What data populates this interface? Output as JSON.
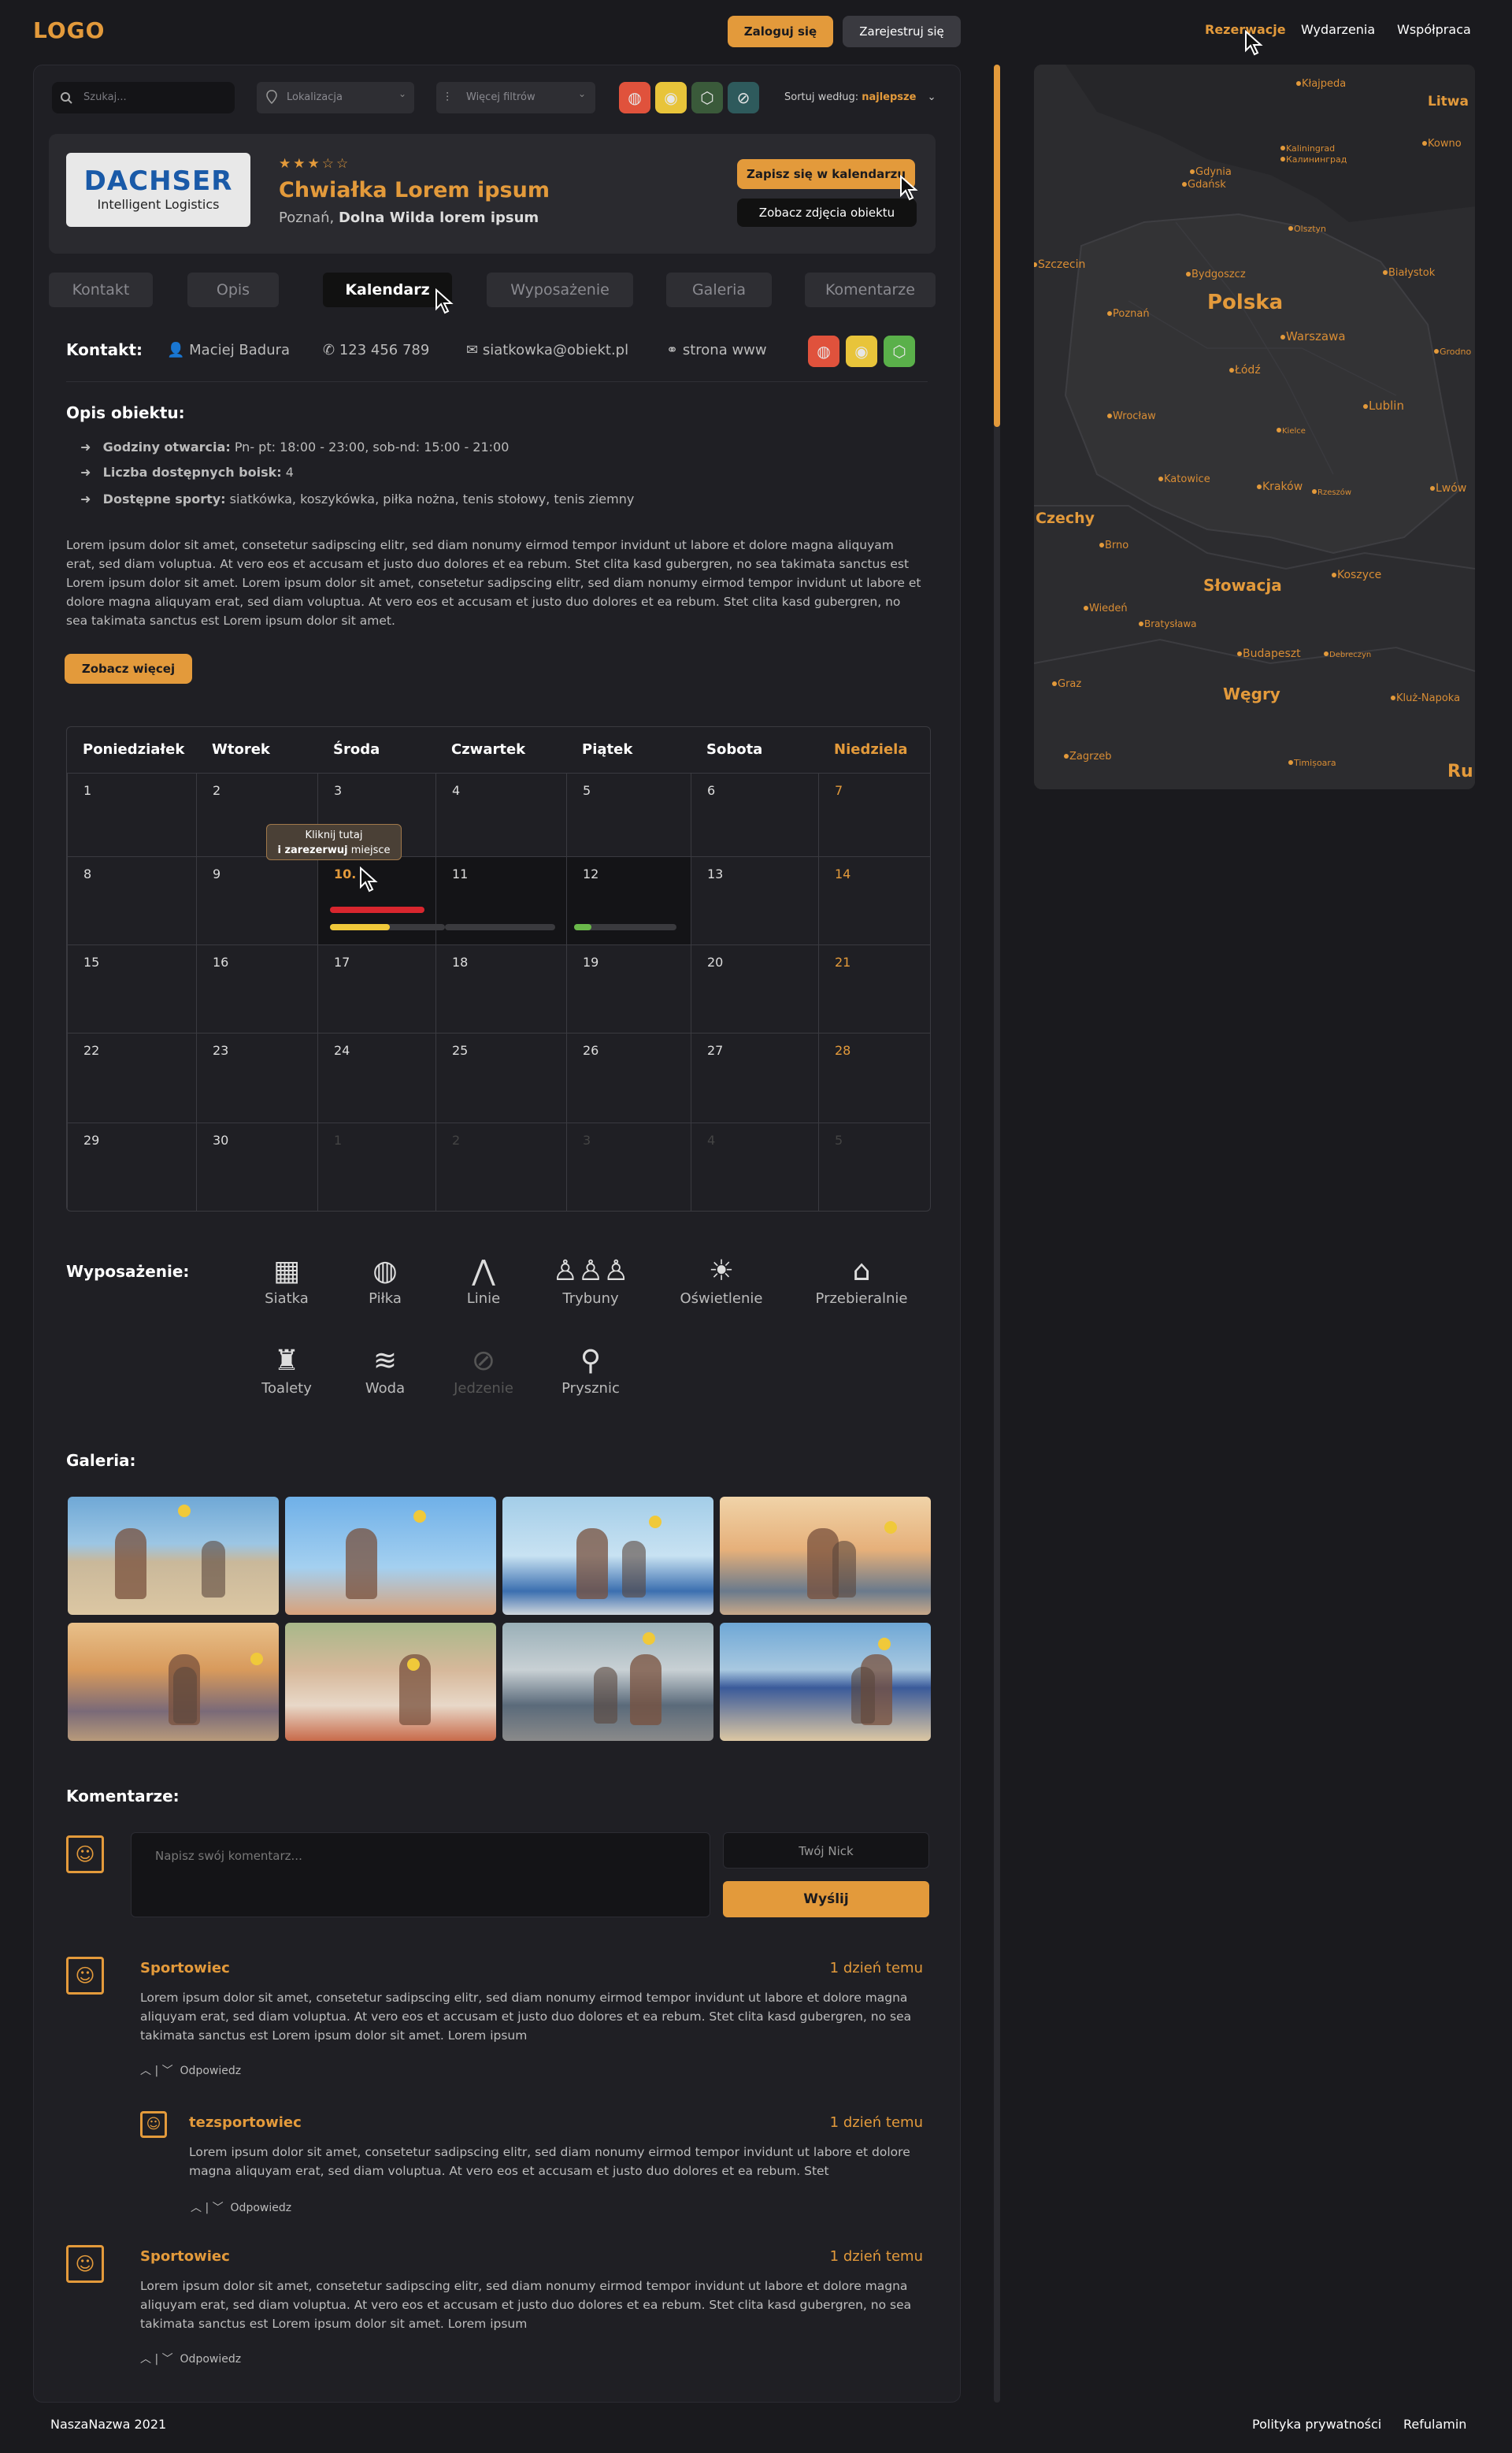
{
  "header": {
    "logo": "LOGO",
    "login": "Zaloguj się",
    "register": "Zarejestruj się",
    "nav": [
      "Rezerwacje",
      "Wydarzenia",
      "Współpraca"
    ]
  },
  "filters": {
    "search_placeholder": "Szukaj...",
    "location": "Lokalizacja",
    "more": "Więcej filtrów",
    "sort_label": "Sortuj według:",
    "sort_value": "najlepsze"
  },
  "facility": {
    "logo_line1": "DACHSER",
    "logo_line2": "Intelligent Logistics",
    "rating": 3.5,
    "stars": "★★★☆☆",
    "name": "Chwiałka Lorem ipsum",
    "city": "Poznań,",
    "street": "Dolna Wilda lorem ipsum",
    "btn_calendar": "Zapisz się w kalendarzu",
    "btn_photos": "Zobacz zdjęcia obiektu"
  },
  "tabs": [
    "Kontakt",
    "Opis",
    "Kalendarz",
    "Wyposażenie",
    "Galeria",
    "Komentarze"
  ],
  "contact": {
    "label": "Kontakt:",
    "person": "Maciej Badura",
    "phone": "123 456 789",
    "email": "siatkowka@obiekt.pl",
    "www": "strona www"
  },
  "description": {
    "heading": "Opis obiektu:",
    "hours_label": "Godziny otwarcia:",
    "hours": "Pn- pt: 18:00 - 23:00,  sob-nd: 15:00 - 21:00",
    "courts_label": "Liczba dostępnych boisk:",
    "courts": "4",
    "sports_label": "Dostępne sporty:",
    "sports": "siatkówka, koszykówka, piłka nożna, tenis stołowy, tenis ziemny",
    "text": "Lorem ipsum dolor sit amet, consetetur sadipscing elitr, sed diam nonumy eirmod tempor invidunt ut labore et dolore magna aliquyam erat, sed diam voluptua. At vero eos et accusam et justo duo dolores et ea rebum. Stet clita kasd gubergren, no sea takimata sanctus est Lorem ipsum dolor sit amet. Lorem ipsum dolor sit amet, consetetur sadipscing elitr, sed diam nonumy eirmod tempor invidunt ut labore et dolore magna aliquyam erat, sed diam voluptua. At vero eos et accusam et justo duo dolores et ea rebum. Stet clita kasd gubergren, no sea takimata sanctus est Lorem ipsum dolor sit amet.",
    "more": "Zobacz więcej"
  },
  "calendar": {
    "days": [
      "Poniedziałek",
      "Wtorek",
      "Środa",
      "Czwartek",
      "Piątek",
      "Sobota",
      "Niedziela"
    ],
    "weeks": [
      [
        "1",
        "2",
        "3",
        "4",
        "5",
        "6",
        "7"
      ],
      [
        "8",
        "9",
        "10.",
        "11",
        "12",
        "13",
        "14"
      ],
      [
        "15",
        "16",
        "17",
        "18",
        "19",
        "20",
        "21"
      ],
      [
        "22",
        "23",
        "24",
        "25",
        "26",
        "27",
        "28"
      ],
      [
        "29",
        "30",
        "1",
        "2",
        "3",
        "4",
        "5"
      ]
    ],
    "tooltip_line1": "Kliknij tutaj",
    "tooltip_b": "i zarezerwuj",
    "tooltip_rest": " miejsce",
    "bars": {
      "day10_red": 0.82,
      "day10_yellow": 0.52,
      "day11_grey": 1.0,
      "day12_green": 0.17
    }
  },
  "equipment": {
    "heading": "Wyposażenie:",
    "items": [
      {
        "label": "Siatka",
        "icon": "net-icon",
        "glyph": "▦",
        "on": true
      },
      {
        "label": "Piłka",
        "icon": "ball-icon",
        "glyph": "◍",
        "on": true
      },
      {
        "label": "Linie",
        "icon": "lines-icon",
        "glyph": "⋀",
        "on": true
      },
      {
        "label": "Trybuny",
        "icon": "stands-icon",
        "glyph": "♙♙♙",
        "on": true
      },
      {
        "label": "Oświetlenie",
        "icon": "light-icon",
        "glyph": "☀",
        "on": true
      },
      {
        "label": "Przebieralnie",
        "icon": "hanger-icon",
        "glyph": "⌂",
        "on": true
      },
      {
        "label": "Toalety",
        "icon": "toilet-icon",
        "glyph": "♜",
        "on": true
      },
      {
        "label": "Woda",
        "icon": "water-icon",
        "glyph": "≋",
        "on": true
      },
      {
        "label": "Jedzenie",
        "icon": "food-icon",
        "glyph": "⊘",
        "on": false
      },
      {
        "label": "Prysznic",
        "icon": "shower-icon",
        "glyph": "⚲",
        "on": true
      }
    ]
  },
  "gallery": {
    "heading": "Galeria:"
  },
  "comments": {
    "heading": "Komentarze:",
    "placeholder": "Napisz swój komentarz...",
    "nick": "Twój Nick",
    "send": "Wyślij",
    "reply": "Odpowiedz",
    "items": [
      {
        "name": "Sportowiec",
        "time": "1 dzień temu",
        "text": "Lorem ipsum dolor sit amet, consetetur sadipscing elitr, sed diam nonumy eirmod tempor invidunt ut labore et dolore magna aliquyam erat, sed diam voluptua. At vero eos et accusam et justo duo dolores et ea rebum. Stet clita kasd gubergren, no sea takimata sanctus est Lorem ipsum dolor sit amet. Lorem ipsum"
      },
      {
        "name": "tezsportowiec",
        "time": "1 dzień temu",
        "text": "Lorem ipsum dolor sit amet, consetetur sadipscing elitr, sed diam nonumy eirmod tempor invidunt ut labore et dolore magna aliquyam erat, sed diam voluptua. At vero eos et accusam et justo duo dolores et ea rebum. Stet"
      },
      {
        "name": "Sportowiec",
        "time": "1 dzień temu",
        "text": "Lorem ipsum dolor sit amet, consetetur sadipscing elitr, sed diam nonumy eirmod tempor invidunt ut labore et dolore magna aliquyam erat, sed diam voluptua. At vero eos et accusam et justo duo dolores et ea rebum. Stet clita kasd gubergren, no sea takimata sanctus est Lorem ipsum dolor sit amet. Lorem ipsum"
      }
    ]
  },
  "map": {
    "labels": [
      "Kłajpeda",
      "Litwa",
      "Kowno",
      "Kaliningrad",
      "Калининград",
      "Gdynia",
      "Gdańsk",
      "Olsztyn",
      "Szczecin",
      "Bydgoszcz",
      "Polska",
      "Białystok",
      "Poznań",
      "Warszawa",
      "Grodno",
      "Łódź",
      "Lublin",
      "Wrocław",
      "Kielce",
      "Katowice",
      "Kraków",
      "Rzeszów",
      "Lwów",
      "Czechy",
      "Brno",
      "Słowacja",
      "Koszyce",
      "Wiedeń",
      "Bratysława",
      "Budapeszt",
      "Debreczyn",
      "Graz",
      "Węgry",
      "Kluż-Napoka",
      "Zagrzeb",
      "Timișoara",
      "Ru"
    ]
  },
  "footer": {
    "copyright": "NaszaNazwa 2021",
    "privacy": "Polityka prywatności",
    "terms": "Refulamin"
  },
  "colors": {
    "accent": "#e39a3b",
    "bg": "#1a1a1e",
    "panel": "#1f1f24"
  }
}
